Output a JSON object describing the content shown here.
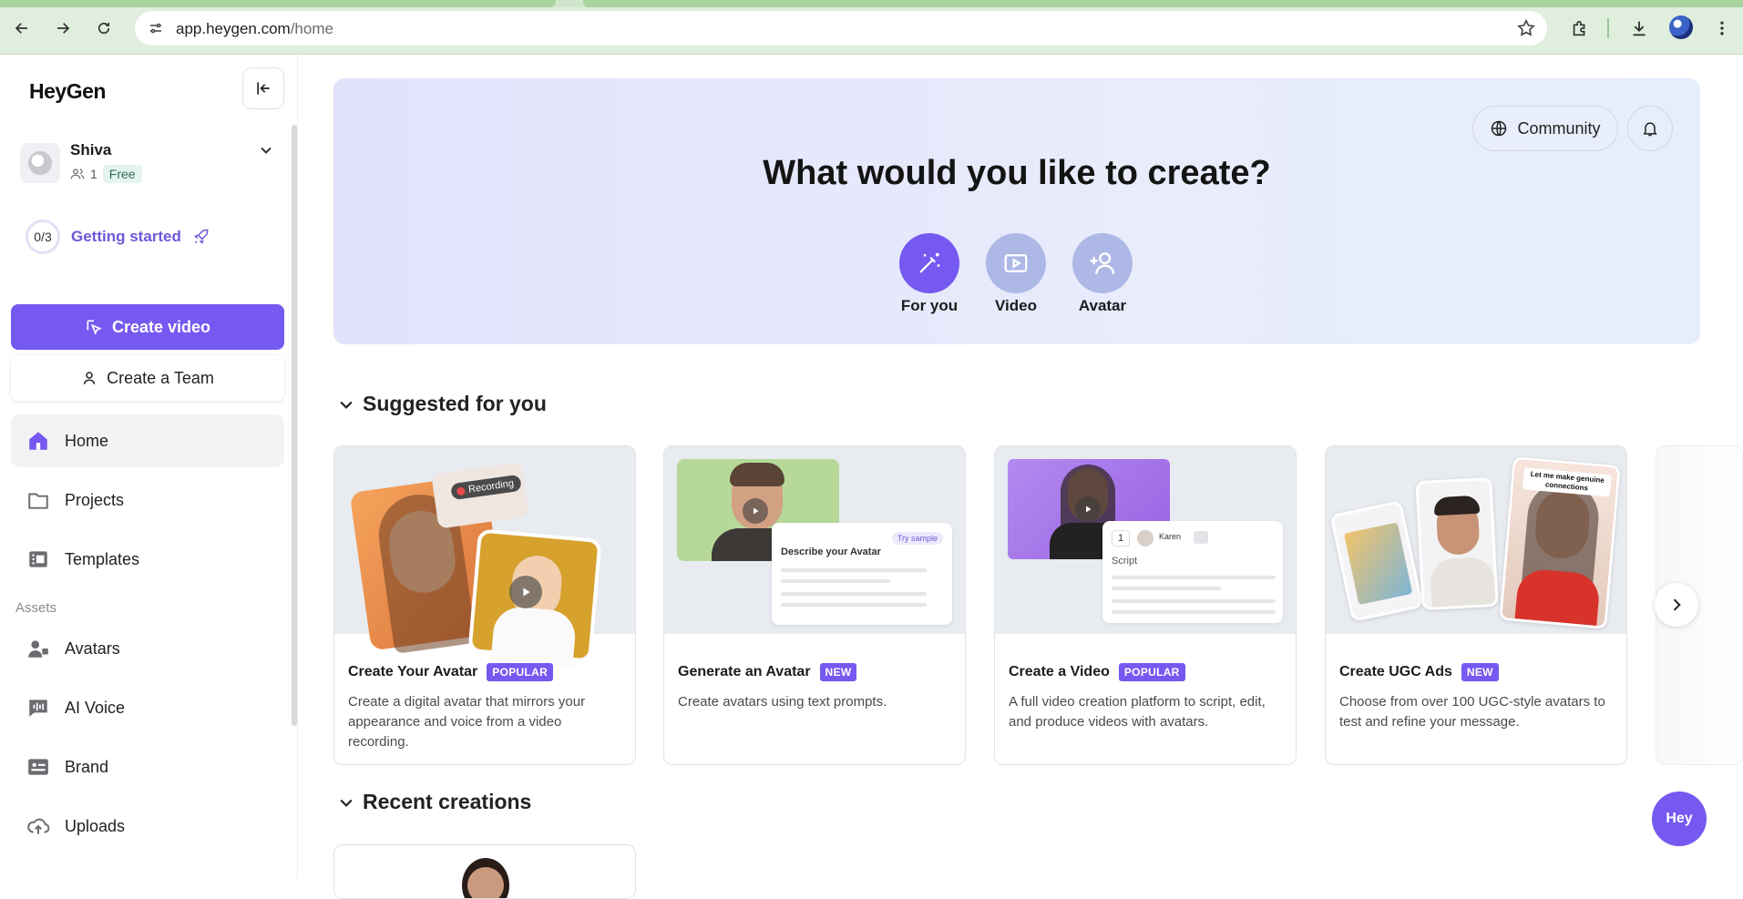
{
  "browser": {
    "url_host": "app.heygen.com",
    "url_path": "/home",
    "icons": [
      "back-arrow-icon",
      "forward-arrow-icon",
      "reload-icon",
      "site-info-icon",
      "bookmark-star-icon",
      "extensions-icon",
      "download-icon",
      "profile-icon",
      "menu-icon"
    ]
  },
  "sidebar": {
    "logo": "HeyGen",
    "user": {
      "name": "Shiva",
      "members": "1",
      "plan": "Free"
    },
    "getting_started": {
      "progress": "0/3",
      "label": "Getting started"
    },
    "create_video": "Create video",
    "create_team": "Create a Team",
    "nav": [
      {
        "label": "Home",
        "icon": "home-icon"
      },
      {
        "label": "Projects",
        "icon": "folder-icon"
      },
      {
        "label": "Templates",
        "icon": "templates-icon"
      }
    ],
    "assets_label": "Assets",
    "assets": [
      {
        "label": "Avatars",
        "icon": "avatars-icon"
      },
      {
        "label": "AI Voice",
        "icon": "ai-voice-icon"
      },
      {
        "label": "Brand",
        "icon": "brand-icon"
      },
      {
        "label": "Uploads",
        "icon": "upload-icon"
      }
    ]
  },
  "hero": {
    "title": "What would you like to create?",
    "community": "Community",
    "options": [
      {
        "label": "For you",
        "icon": "magic-wand-icon",
        "color": "#7559f0"
      },
      {
        "label": "Video",
        "icon": "video-icon",
        "color": "#aeb8e6"
      },
      {
        "label": "Avatar",
        "icon": "add-person-icon",
        "color": "#aeb8e6"
      }
    ]
  },
  "suggested": {
    "heading": "Suggested for you",
    "cards": [
      {
        "title": "Create Your Avatar",
        "badge": "POPULAR",
        "desc": "Create a digital avatar that mirrors your appearance and voice from a video recording.",
        "thumb_tag": "Recording"
      },
      {
        "title": "Generate an Avatar",
        "badge": "NEW",
        "desc": "Create avatars using text prompts.",
        "thumb_tag": "Describe your Avatar",
        "thumb_tag2": "Try sample"
      },
      {
        "title": "Create a Video",
        "badge": "POPULAR",
        "desc": "A full video creation platform to script, edit, and produce videos with avatars.",
        "thumb_tag": "Script",
        "thumb_tag2": "Karen",
        "thumb_num": "1"
      },
      {
        "title": "Create UGC Ads",
        "badge": "NEW",
        "desc": "Choose from over 100 UGC-style avatars to test and refine your message.",
        "thumb_tag": "Let me make genuine connections"
      }
    ]
  },
  "recent": {
    "heading": "Recent creations"
  },
  "fab": {
    "label": "Hey"
  },
  "colors": {
    "accent": "#7559f0",
    "chrome": "#dfeedd"
  }
}
